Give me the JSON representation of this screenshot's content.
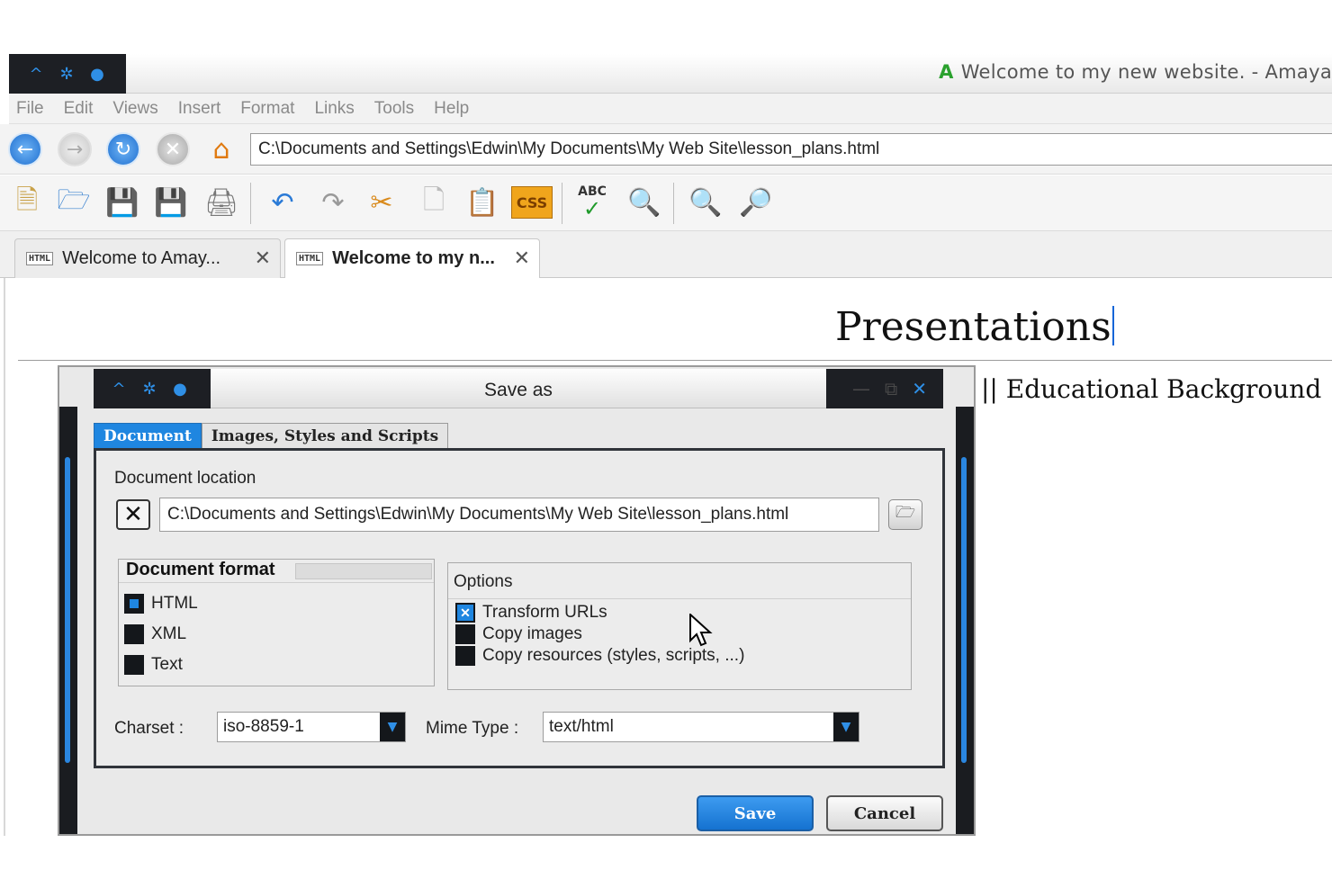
{
  "window": {
    "title": "Welcome to my new website. - Amaya",
    "app_logo": "A",
    "wm_buttons": [
      "^",
      "✲",
      "●"
    ]
  },
  "menu": [
    {
      "label": "File"
    },
    {
      "label": "Edit"
    },
    {
      "label": "Views"
    },
    {
      "label": "Insert"
    },
    {
      "label": "Format"
    },
    {
      "label": "Links"
    },
    {
      "label": "Tools"
    },
    {
      "label": "Help"
    }
  ],
  "navbar": {
    "url": "C:\\Documents and Settings\\Edwin\\My Documents\\My Web Site\\lesson_plans.html",
    "buttons": [
      "back-icon",
      "forward-icon",
      "reload-icon",
      "stop-icon",
      "home-icon"
    ]
  },
  "toolbar": {
    "css_label": "CSS",
    "spell_label": "ABC"
  },
  "tabs": [
    {
      "label": "Welcome to Amay...",
      "icon_text": "HTML",
      "active": false
    },
    {
      "label": "Welcome to my n...",
      "icon_text": "HTML",
      "active": true
    }
  ],
  "document": {
    "heading": "Presentations",
    "nav_text": "|| Educational Background || Res"
  },
  "dialog": {
    "title": "Save as",
    "tabs": [
      {
        "label": "Document",
        "active": true
      },
      {
        "label": "Images, Styles and Scripts",
        "active": false
      }
    ],
    "location_label": "Document location",
    "location_value": "C:\\Documents and Settings\\Edwin\\My Documents\\My Web Site\\lesson_plans.html",
    "format": {
      "legend": "Document format",
      "options": [
        {
          "label": "HTML",
          "selected": true
        },
        {
          "label": "XML",
          "selected": false
        },
        {
          "label": "Text",
          "selected": false
        }
      ]
    },
    "options": {
      "legend": "Options",
      "items": [
        {
          "label": "Transform URLs",
          "checked": true
        },
        {
          "label": "Copy images",
          "checked": false
        },
        {
          "label": "Copy resources (styles, scripts, ...)",
          "checked": false
        }
      ]
    },
    "charset": {
      "label": "Charset :",
      "value": "iso-8859-1"
    },
    "mime": {
      "label": "Mime Type :",
      "value": "text/html"
    },
    "save_label": "Save",
    "cancel_label": "Cancel"
  },
  "colors": {
    "accent": "#1f86e0",
    "wm_dark": "#1d1f24"
  }
}
